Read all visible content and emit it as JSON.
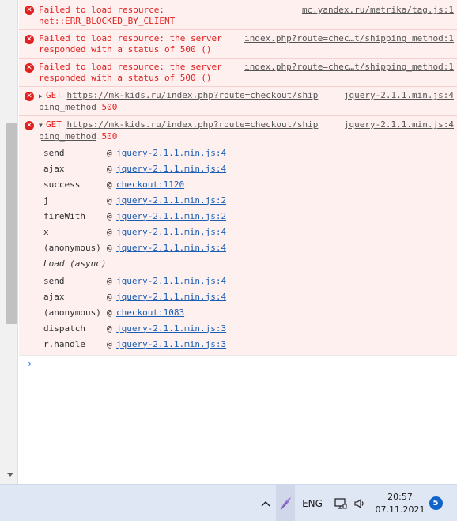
{
  "messages": [
    {
      "lines": [
        "Failed to load resource:",
        "net::ERR_BLOCKED_BY_CLIENT"
      ],
      "source": "mc.yandex.ru/metrika/tag.js:1"
    },
    {
      "lines": [
        "Failed to load resource: the server",
        "responded with a status of 500 ()"
      ],
      "source": "index.php?route=chec…t/shipping_method:1"
    },
    {
      "lines": [
        "Failed to load resource: the server",
        "responded with a status of 500 ()"
      ],
      "source": "index.php?route=chec…t/shipping_method:1"
    }
  ],
  "get_collapsed": {
    "method": "GET",
    "url_line1": "https://mk-kids.ru/index.php?route=checkout/ship",
    "url_line2": "ping_method",
    "status": "500",
    "source": "jquery-2.1.1.min.js:4"
  },
  "get_expanded": {
    "method": "GET",
    "url_line1": "https://mk-kids.ru/index.php?route=checkout/ship",
    "url_line2": "ping_method",
    "status": "500",
    "source": "jquery-2.1.1.min.js:4"
  },
  "stack": [
    {
      "fn": "send",
      "loc": "jquery-2.1.1.min.js:4"
    },
    {
      "fn": "ajax",
      "loc": "jquery-2.1.1.min.js:4"
    },
    {
      "fn": "success",
      "loc": "checkout:1120"
    },
    {
      "fn": "j",
      "loc": "jquery-2.1.1.min.js:2"
    },
    {
      "fn": "fireWith",
      "loc": "jquery-2.1.1.min.js:2"
    },
    {
      "fn": "x",
      "loc": "jquery-2.1.1.min.js:4"
    },
    {
      "fn": "(anonymous)",
      "loc": "jquery-2.1.1.min.js:4"
    }
  ],
  "async_label": "Load (async)",
  "stack2": [
    {
      "fn": "send",
      "loc": "jquery-2.1.1.min.js:4"
    },
    {
      "fn": "ajax",
      "loc": "jquery-2.1.1.min.js:4"
    },
    {
      "fn": "(anonymous)",
      "loc": "checkout:1083"
    },
    {
      "fn": "dispatch",
      "loc": "jquery-2.1.1.min.js:3"
    },
    {
      "fn": "r.handle",
      "loc": "jquery-2.1.1.min.js:3"
    }
  ],
  "prompt_symbol": "›",
  "at_symbol": "@",
  "taskbar": {
    "language": "ENG",
    "time": "20:57",
    "date": "07.11.2021",
    "notifications": "5"
  },
  "colors": {
    "error": "#e0201e",
    "link": "#1a5fb4",
    "taskbar_bg": "#dfe6f4",
    "badge": "#1063c9"
  }
}
